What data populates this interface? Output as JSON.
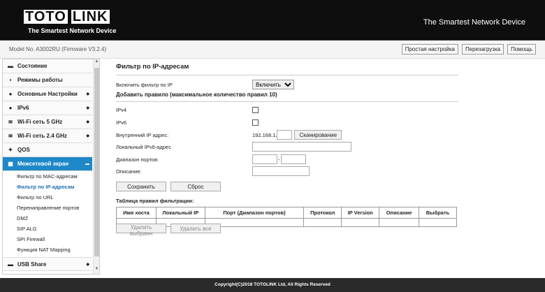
{
  "header": {
    "logo_left": "TOTO",
    "logo_right": "LINK",
    "logo_sub": "The Smartest Network Device",
    "tagline": "The Smartest Network Device"
  },
  "modelbar": {
    "model": "Model No. A3002RU (Firmware V3.2.4)",
    "buttons": [
      "Простая настройка",
      "Перезагрузка",
      "Помощь"
    ]
  },
  "sidebar": {
    "items": [
      {
        "label": "Состояние",
        "icon": "monitor-icon"
      },
      {
        "label": "Режимы работы",
        "icon": "mode-icon"
      },
      {
        "label": "Основные Настройки",
        "icon": "globe-icon"
      },
      {
        "label": "IPv6",
        "icon": "globe-icon"
      },
      {
        "label": "Wi-Fi сеть 5 GHz",
        "icon": "wifi-icon"
      },
      {
        "label": "Wi-Fi сеть 2.4 GHz",
        "icon": "wifi-icon"
      },
      {
        "label": "QOS",
        "icon": "qos-icon"
      },
      {
        "label": "Межсетевой экран",
        "icon": "firewall-icon"
      }
    ],
    "subitems": [
      "Фильтр по MAC-адресам",
      "Фильтр по IP-адресам",
      "Фильтр по URL",
      "Перенаправление портов",
      "DMZ",
      "SIP ALG",
      "SPI Firewall",
      "Функция NAT Mapping"
    ],
    "last_item": "USB Share"
  },
  "main": {
    "title": "Фильтр по IP-адресам",
    "enable_label": "Включить фильтр по IP",
    "enable_value": "Включить",
    "add_rule_title": "Добавить правило (максимальное количество правил 10)",
    "ipv4_label": "IPv4",
    "ipv6_label": "IPv6",
    "internal_ip_label": "Внутренний IP адрес:",
    "ip_prefix": "192.168.1.",
    "scan_button": "Сканирование",
    "local_ipv6_label": "Локальный IPv6-адрес",
    "port_range_label": "Диапазон портов:",
    "port_dash": "-",
    "description_label": "Описание:",
    "save_button": "Сохранить",
    "reset_button": "Сброс",
    "table_title": "Таблица правил фильтрации:",
    "columns": [
      "Имя хоста",
      "Локальный IP",
      "Порт (Диапазон портов)",
      "Протокол",
      "IP Version",
      "Описание",
      "Выбрать"
    ],
    "delete_selected": "Удалить выбранн",
    "delete_all": "Удалить все"
  },
  "footer": {
    "copyright": "Copyright(C)2018 TOTOLINK Ltd, All Rights Reserved"
  }
}
